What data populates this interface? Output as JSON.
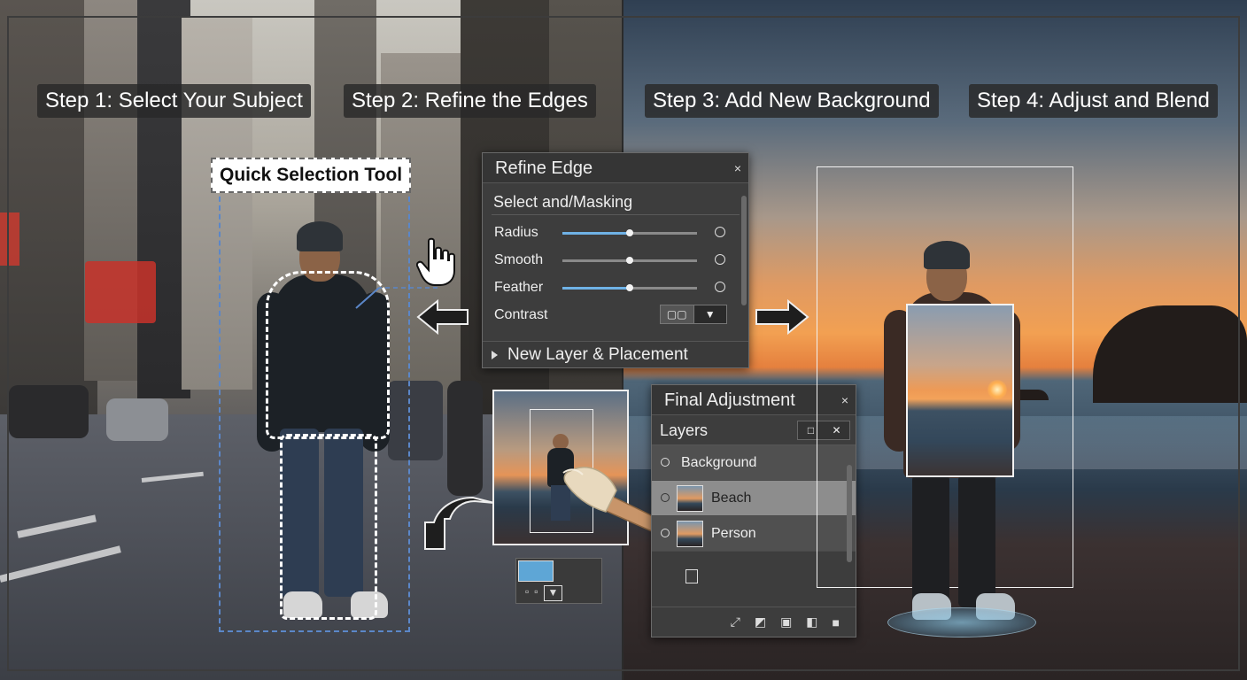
{
  "steps": {
    "step1": "Step 1: Select Your Subject",
    "step2": "Step 2: Refine the Edges",
    "step3": "Step 3: Add New Background",
    "step4": "Step 4: Adjust and Blend"
  },
  "tool_label": "Quick Selection Tool",
  "refine_edge": {
    "title": "Refine Edge",
    "close": "×",
    "subtitle": "Select and/Masking",
    "sliders": [
      {
        "label": "Radius",
        "value": 0.5
      },
      {
        "label": "Smooth",
        "value": 0.5
      },
      {
        "label": "Feather",
        "value": 0.5
      }
    ],
    "contrast_label": "Contrast",
    "contrast_buttons": [
      "▢▢",
      "▼"
    ],
    "section": "New Layer & Placement"
  },
  "final_adjustment": {
    "title": "Final Adjustment",
    "close": "×",
    "layers_title": "Layers",
    "layers_head_buttons": [
      "□",
      "✕"
    ],
    "layers": [
      {
        "name": "Background",
        "selected": false,
        "thumb": false
      },
      {
        "name": "Beach",
        "selected": true,
        "thumb": true
      },
      {
        "name": "Person",
        "selected": false,
        "thumb": true
      }
    ],
    "footer_icons": [
      "link-icon",
      "adjust-icon",
      "image-icon",
      "mask-icon",
      "new-layer-icon"
    ]
  },
  "mini_bar_buttons": [
    "▫",
    "▫",
    "▼"
  ],
  "colors": {
    "panel_bg": "#3d3d3d",
    "slider_fill": "#6fb2e6",
    "selection_blue": "#5b87c9",
    "sunset_orange": "#e5803e"
  }
}
